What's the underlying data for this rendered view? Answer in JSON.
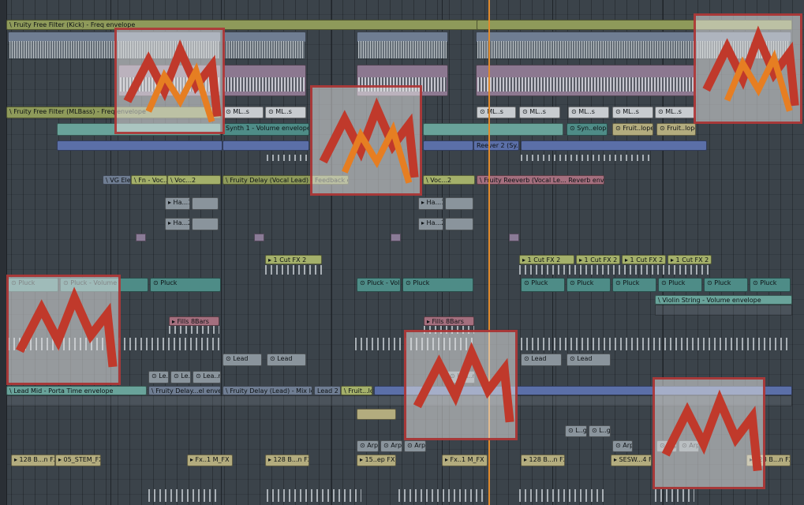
{
  "playlist": {
    "clips": {
      "kick_filter": "\\ Fruity Free Filter (Kick) - Freq envelope",
      "mlbass_filter": "\\ Fruity Free Filter (MLBass) - Freq envelope",
      "ml_s": "⊙ ML..s",
      "synth1_vol": "Synth 1 - Volume envelope",
      "syn_elope": "⊙ Syn..elope",
      "fruit_lope": "⊙ Fruit..lope",
      "vg_elect": "\\ VG Elect",
      "fn_voc": "\\ Fn - Voc..1",
      "voc2": "\\ Voc...2",
      "delay_vocal": "\\ Fruity Delay (Vocal Lead) - Feedback envelope",
      "reeverb_vocal": "\\ Fruity Reeverb (Vocal Le...  Reverb envelope",
      "ha1": "▸ Ha...1",
      "ha2": "▸ Ha...2",
      "cut_fx": "▸ 1 Cut FX 2",
      "pluck": "⊙ Pluck",
      "pluck_vol": "⊙ Pluck - Volume",
      "violin": "\\ Violin String - Volume envelope",
      "fills": "▸ Fills 8Bars",
      "lead": "⊙ Lead",
      "le_s": "⊙ Le...s",
      "lea_rs": "⊙ Lea..rs",
      "lead_mid": "\\ Lead Mid - Porta Time envelope",
      "delay_el": "\\ Fruity Delay...el envelope",
      "delay_lead": "\\ Fruity Delay (Lead) - Mix level",
      "lead2": "Lead 2",
      "fruit_lope2": "\\ Fruit...lope",
      "arp": "⊙ Arp",
      "l_gh": "⊙ L..gh",
      "fx128": "▸ 128 B...n FX 2",
      "stem_fx": "▸ 05_STEM_FX",
      "fx1m": "▸ Fx..1 M_FX",
      "fx15": "▸ 15..ep FX",
      "sesw": "▸ SESW...4 FX",
      "reever2": "Reever 2 (Sy..."
    }
  },
  "colors": {
    "playhead": "#e08a2c",
    "watermark_border": "#aa2828",
    "watermark_line": "#c0392b"
  },
  "icons": {
    "watermark": "red-zigzag-logo"
  }
}
